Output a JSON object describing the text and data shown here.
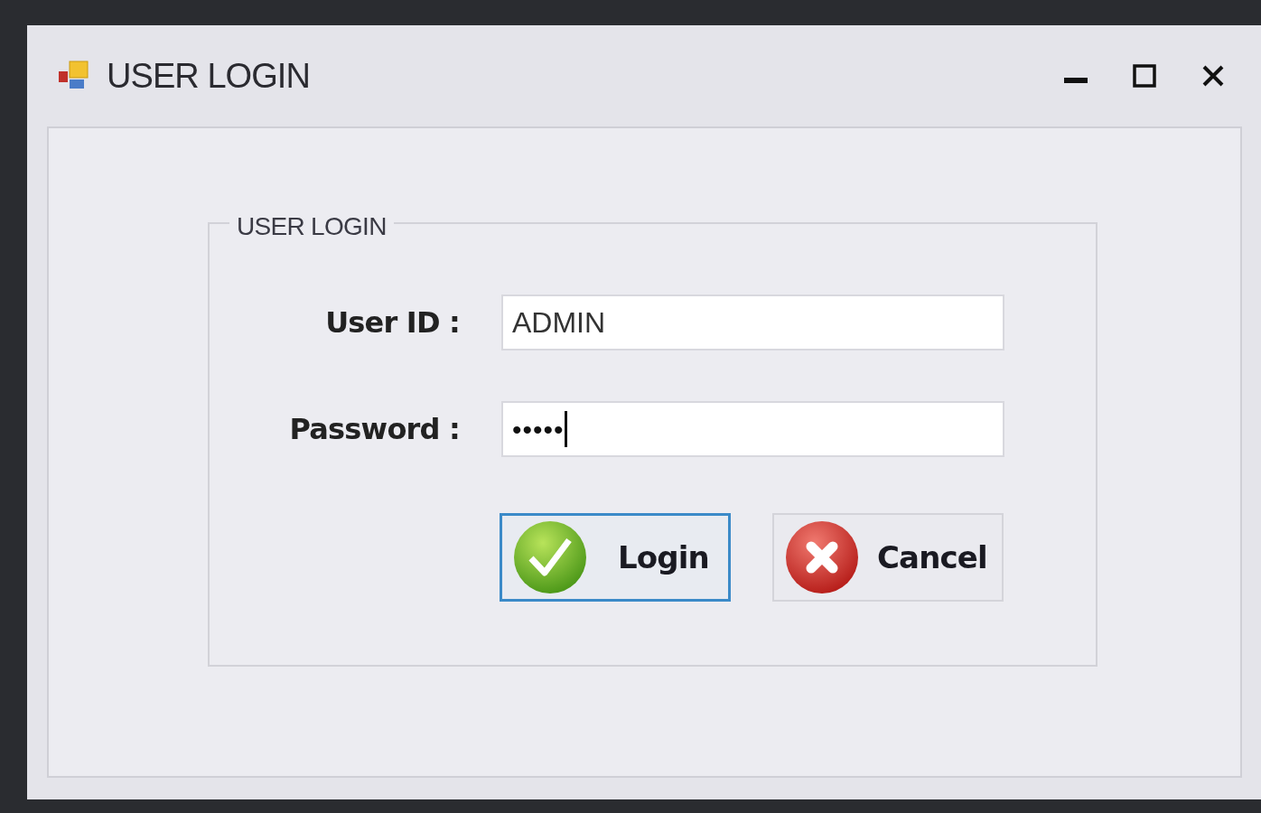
{
  "window": {
    "title": "USER LOGIN",
    "controls": [
      {
        "kind": "minimize"
      },
      {
        "kind": "maximize"
      },
      {
        "kind": "close"
      }
    ]
  },
  "group": {
    "legend": "USER LOGIN"
  },
  "fields": [
    {
      "label": "User ID :",
      "kind": "text",
      "value": "ADMIN",
      "caret": false
    },
    {
      "label": "Password :",
      "kind": "password",
      "value": "•••••",
      "caret": true
    }
  ],
  "buttons": [
    {
      "label": "Login",
      "kind": "confirm",
      "focused": true
    },
    {
      "label": "Cancel",
      "kind": "cancel",
      "focused": false
    }
  ]
}
